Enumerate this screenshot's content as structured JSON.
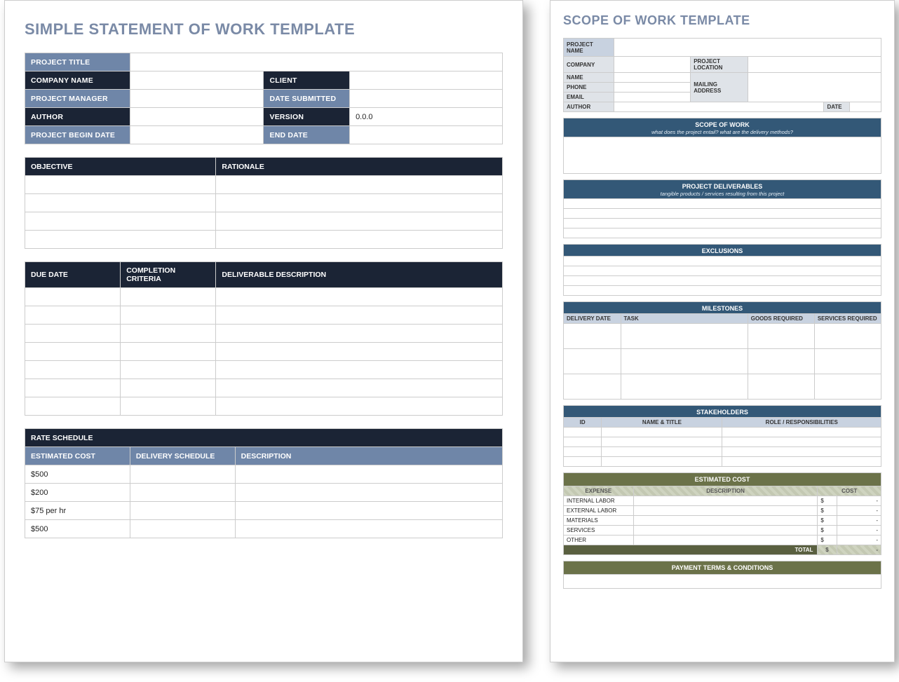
{
  "page1": {
    "title": "SIMPLE STATEMENT OF WORK TEMPLATE",
    "header": {
      "project_title_label": "PROJECT TITLE",
      "company_name_label": "COMPANY NAME",
      "client_label": "CLIENT",
      "project_manager_label": "PROJECT MANAGER",
      "date_submitted_label": "DATE SUBMITTED",
      "author_label": "AUTHOR",
      "version_label": "VERSION",
      "version_value": "0.0.0",
      "begin_date_label": "PROJECT BEGIN DATE",
      "end_date_label": "END DATE"
    },
    "objective": {
      "objective_label": "OBJECTIVE",
      "rationale_label": "RATIONALE"
    },
    "deliverables": {
      "due_date_label": "DUE DATE",
      "completion_label": "COMPLETION CRITERIA",
      "description_label": "DELIVERABLE DESCRIPTION"
    },
    "rate": {
      "section_label": "RATE SCHEDULE",
      "estimated_cost_label": "ESTIMATED COST",
      "delivery_schedule_label": "DELIVERY SCHEDULE",
      "description_label": "DESCRIPTION",
      "rows": [
        "$500",
        "$200",
        "$75 per hr",
        "$500"
      ]
    }
  },
  "page2": {
    "title": "SCOPE OF WORK TEMPLATE",
    "info": {
      "project_name_label": "PROJECT NAME",
      "company_label": "COMPANY",
      "project_location_label": "PROJECT LOCATION",
      "name_label": "NAME",
      "mailing_address_label": "MAILING ADDRESS",
      "phone_label": "PHONE",
      "email_label": "EMAIL",
      "author_label": "AUTHOR",
      "date_label": "DATE"
    },
    "scope": {
      "title": "SCOPE OF WORK",
      "sub": "what does the project entail? what are the delivery methods?"
    },
    "deliverables": {
      "title": "PROJECT DELIVERABLES",
      "sub": "tangible products / services resulting from this project"
    },
    "exclusions": {
      "title": "EXCLUSIONS"
    },
    "milestones": {
      "title": "MILESTONES",
      "delivery_date_label": "DELIVERY DATE",
      "task_label": "TASK",
      "goods_label": "GOODS REQUIRED",
      "services_label": "SERVICES REQUIRED"
    },
    "stakeholders": {
      "title": "STAKEHOLDERS",
      "id_label": "ID",
      "name_title_label": "NAME & TITLE",
      "role_label": "ROLE / RESPONSIBILITIES"
    },
    "cost": {
      "title": "ESTIMATED COST",
      "expense_label": "EXPENSE",
      "description_label": "DESCRIPTION",
      "cost_label": "COST",
      "rows": [
        "INTERNAL LABOR",
        "EXTERNAL LABOR",
        "MATERIALS",
        "SERVICES",
        "OTHER"
      ],
      "currency": "$",
      "dash": "-",
      "total_label": "TOTAL"
    },
    "payment": {
      "title": "PAYMENT TERMS & CONDITIONS"
    }
  }
}
